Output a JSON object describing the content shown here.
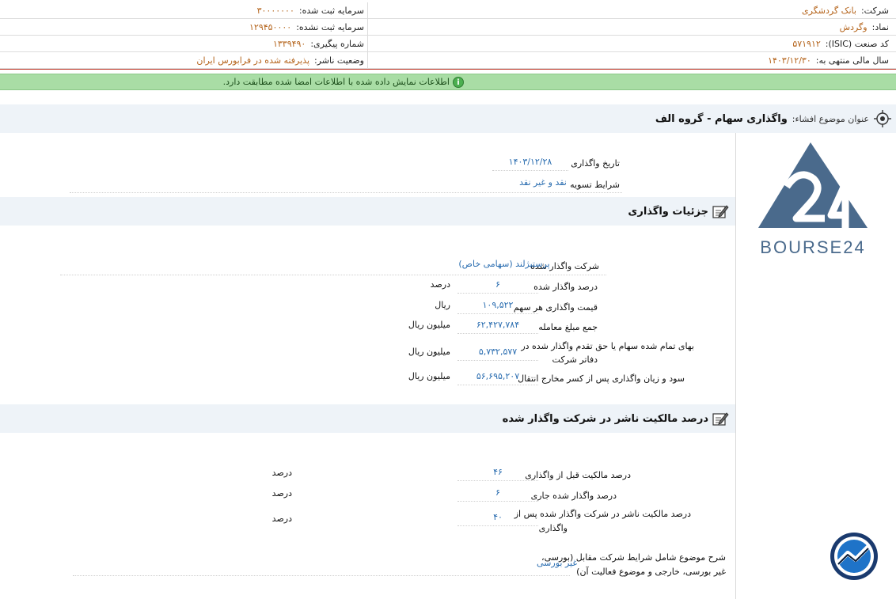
{
  "header": {
    "company_label": "شرکت:",
    "company_value": "بانک گردشگری",
    "capital_registered_label": "سرمایه ثبت شده:",
    "capital_registered_value": "۳۰۰۰۰۰۰۰",
    "symbol_label": "نماد:",
    "symbol_value": "وگردش",
    "capital_unregistered_label": "سرمایه ثبت نشده:",
    "capital_unregistered_value": "۱۲۹۴۵۰۰۰۰",
    "isic_label": "کد صنعت (ISIC):",
    "isic_value": "۵۷۱۹۱۲",
    "tracking_label": "شماره پیگیری:",
    "tracking_value": "۱۳۳۹۴۹۰",
    "fiscal_label": "سال مالی منتهی به:",
    "fiscal_value": "۱۴۰۳/۱۲/۳۰",
    "publisher_status_label": "وضعیت ناشر:",
    "publisher_status_value": "پذیرفته شده در فرابورس ایران"
  },
  "banner": {
    "icon": "info-icon",
    "text": "اطلاعات نمایش داده شده با اطلاعات امضا شده مطابقت دارد."
  },
  "subject": {
    "icon": "target-icon",
    "label": "عنوان موضوع افشاء:",
    "title": "واگذاری سهام - گروه الف"
  },
  "transfer": {
    "date_label": "تاریخ واگذاری",
    "date_value": "۱۴۰۳/۱۲/۲۸",
    "settlement_label": "شرایط تسویه",
    "settlement_value": "نقد و غیر نقد"
  },
  "details": {
    "title": "جزئیات واگذاری",
    "icon": "edit-icon",
    "rows": [
      {
        "label": "شرکت واگذار شده",
        "value": "پرستیژلند (سهامی خاص)",
        "unit": ""
      },
      {
        "label": "درصد واگذار شده",
        "value": "۶",
        "unit": "درصد"
      },
      {
        "label": "قیمت واگذاری هر سهم",
        "value": "۱۰۹,۵۲۲",
        "unit": "ریال"
      },
      {
        "label": "جمع مبلغ معامله",
        "value": "۶۲,۴۲۷,۷۸۴",
        "unit": "میلیون ریال"
      },
      {
        "label_line1": "بهای تمام شده سهام یا حق تقدم واگذار شده در",
        "label_line2": "دفاتر شرکت",
        "value": "۵,۷۳۲,۵۷۷",
        "unit": "میلیون ریال"
      },
      {
        "label": "سود و زیان واگذاری پس از کسر مخارج انتقال",
        "value": "۵۶,۶۹۵,۲۰۷",
        "unit": "میلیون ریال"
      }
    ]
  },
  "ownership": {
    "title": "درصد مالکیت ناشر در شرکت واگذار شده",
    "icon": "edit-icon",
    "rows": [
      {
        "label": "درصد مالکیت قبل از واگذاری",
        "value": "۴۶",
        "unit": "درصد"
      },
      {
        "label": "درصد واگذار شده جاری",
        "value": "۶",
        "unit": "درصد"
      },
      {
        "label_line1": "درصد مالکیت ناشر در شرکت واگذار شده پس از",
        "label_line2": "واگذاری",
        "value": "۴۰",
        "unit": "درصد"
      }
    ],
    "desc_label_line1": "شرح موضوع شامل شرایط شرکت مقابل (بورسی،",
    "desc_label_line2": "غیر بورسی، خارجی و موضوع فعالیت آن)",
    "desc_value": "غیر بورسی"
  },
  "side": {
    "logo_text": "BOURSE24",
    "logo_icon": "bourse24-logo-icon",
    "badge_icon": "chart-badge-icon"
  },
  "colors": {
    "header_value": "#b5651d",
    "field_value": "#2a6db0",
    "banner_bg": "#a9dda5",
    "section_bg": "#eef3f8",
    "logo": "#4a6a8c",
    "header_border": "#c0392b"
  }
}
